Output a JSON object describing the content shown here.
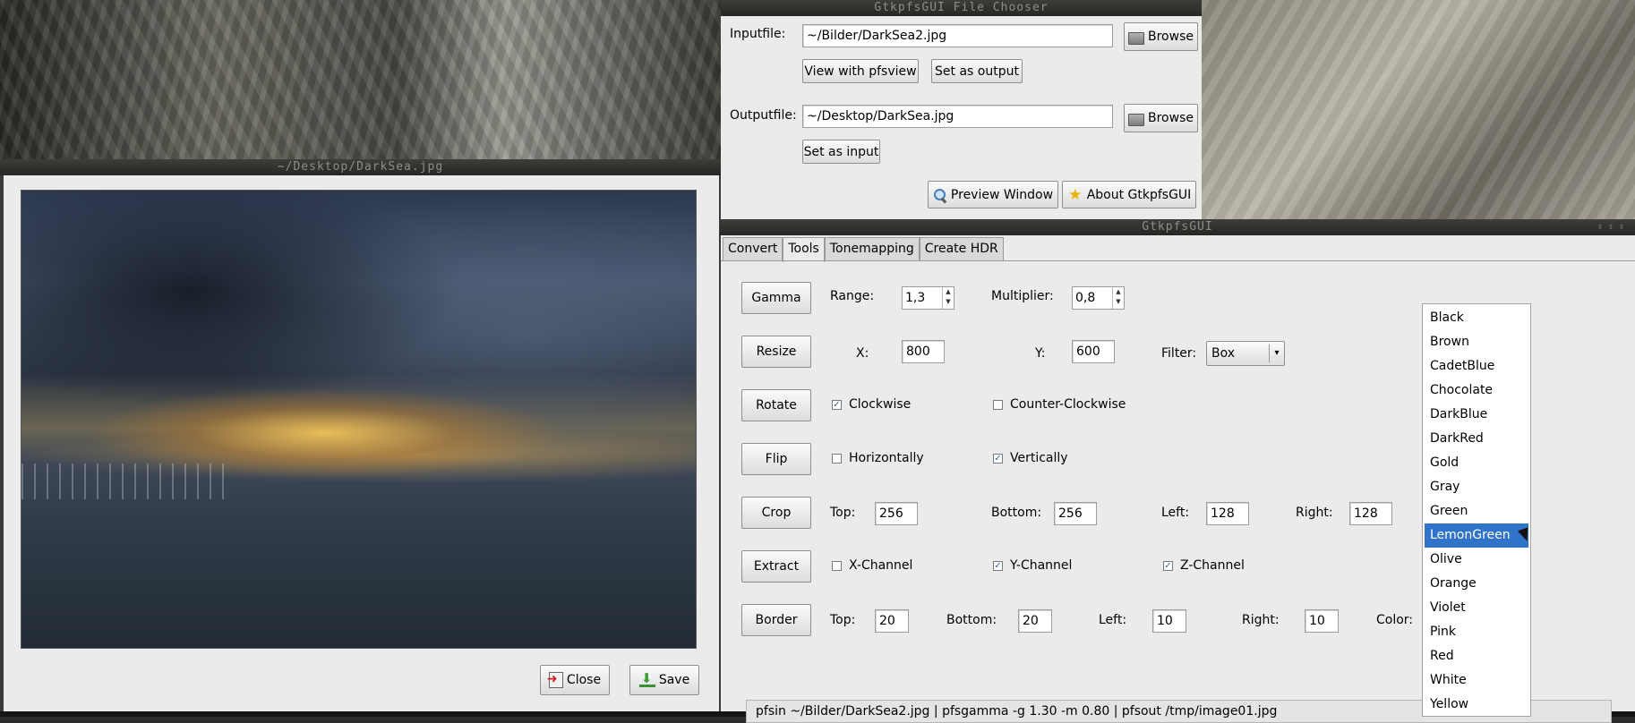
{
  "chooser": {
    "title": "GtkpfsGUI File Chooser",
    "input_label": "Inputfile:",
    "input_value": "~/Bilder/DarkSea2.jpg",
    "browse_label": "Browse",
    "view_pfsview_label": "View with pfsview",
    "set_output_label": "Set as output",
    "output_label": "Outputfile:",
    "output_value": "~/Desktop/DarkSea.jpg",
    "set_input_label": "Set as input",
    "preview_window_label": "Preview Window",
    "about_label": "About GtkpfsGUI"
  },
  "preview": {
    "title": "~/Desktop/DarkSea.jpg",
    "close_label": "Close",
    "save_label": "Save"
  },
  "main": {
    "title": "GtkpfsGUI",
    "tabs": [
      {
        "label": "Convert"
      },
      {
        "label": "Tools"
      },
      {
        "label": "Tonemapping"
      },
      {
        "label": "Create HDR"
      }
    ],
    "gamma": {
      "button": "Gamma",
      "range_label": "Range:",
      "range_value": "1,3",
      "multiplier_label": "Multiplier:",
      "multiplier_value": "0,8"
    },
    "resize": {
      "button": "Resize",
      "x_label": "X:",
      "x_value": "800",
      "y_label": "Y:",
      "y_value": "600",
      "filter_label": "Filter:",
      "filter_value": "Box"
    },
    "rotate": {
      "button": "Rotate",
      "clockwise_label": "Clockwise",
      "clockwise_checked": true,
      "counter_label": "Counter-Clockwise",
      "counter_checked": false
    },
    "flip": {
      "button": "Flip",
      "horizontal_label": "Horizontally",
      "horizontal_checked": false,
      "vertical_label": "Vertically",
      "vertical_checked": true
    },
    "crop": {
      "button": "Crop",
      "top_label": "Top:",
      "top_value": "256",
      "bottom_label": "Bottom:",
      "bottom_value": "256",
      "left_label": "Left:",
      "left_value": "128",
      "right_label": "Right:",
      "right_value": "128"
    },
    "extract": {
      "button": "Extract",
      "x_label": "X-Channel",
      "x_checked": false,
      "y_label": "Y-Channel",
      "y_checked": true,
      "z_label": "Z-Channel",
      "z_checked": true
    },
    "border": {
      "button": "Border",
      "top_label": "Top:",
      "top_value": "20",
      "bottom_label": "Bottom:",
      "bottom_value": "20",
      "left_label": "Left:",
      "left_value": "10",
      "right_label": "Right:",
      "right_value": "10",
      "color_label": "Color:"
    },
    "command": "pfsin ~/Bilder/DarkSea2.jpg | pfsgamma -g 1.30 -m 0.80 | pfsout  /tmp/image01.jpg"
  },
  "color_options": [
    "Black",
    "Brown",
    "CadetBlue",
    "Chocolate",
    "DarkBlue",
    "DarkRed",
    "Gold",
    "Gray",
    "Green",
    "LemonGreen",
    "Olive",
    "Orange",
    "Violet",
    "Pink",
    "Red",
    "White",
    "Yellow"
  ],
  "color_selected": "LemonGreen",
  "accent_color": "#2f74c8"
}
